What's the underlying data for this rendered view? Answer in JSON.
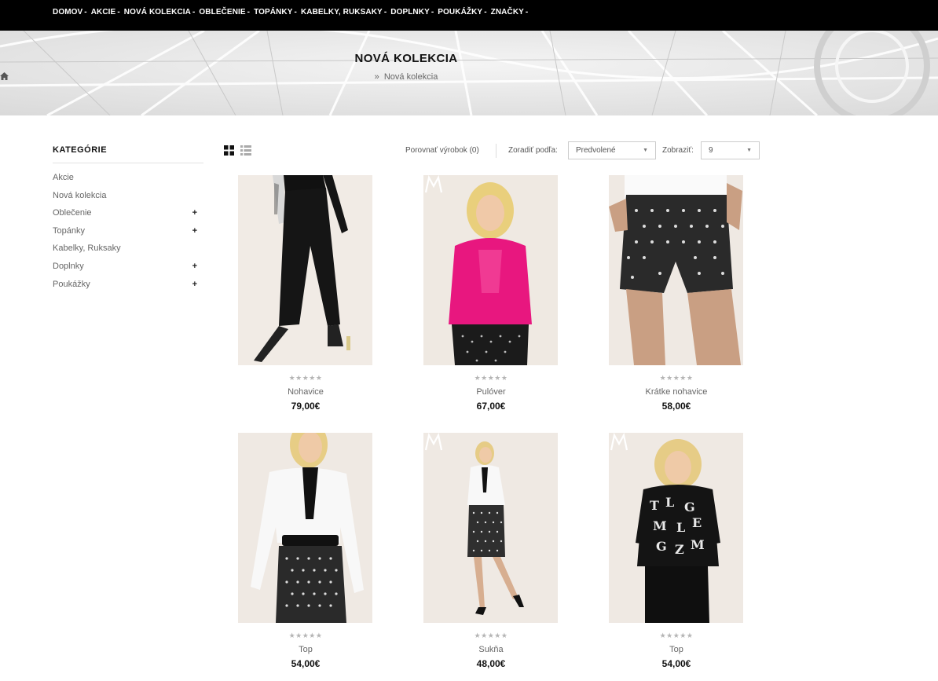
{
  "nav": {
    "items": [
      "DOMOV",
      "AKCIE",
      "NOVÁ KOLEKCIA",
      "OBLEČENIE",
      "TOPÁNKY",
      "KABELKY, RUKSAKY",
      "DOPLNKY",
      "POUKÁŽKY",
      "ZNAČKY"
    ],
    "separator": "-"
  },
  "banner": {
    "title": "NOVÁ KOLEKCIA",
    "breadcrumb_arrow": "»",
    "breadcrumb_current": "Nová kolekcia"
  },
  "sidebar": {
    "title": "KATEGÓRIE",
    "items": [
      {
        "label": "Akcie",
        "expandable": false
      },
      {
        "label": "Nová kolekcia",
        "expandable": false
      },
      {
        "label": "Oblečenie",
        "expandable": true
      },
      {
        "label": "Topánky",
        "expandable": true
      },
      {
        "label": "Kabelky, Ruksaky",
        "expandable": false
      },
      {
        "label": "Doplnky",
        "expandable": true
      },
      {
        "label": "Poukážky",
        "expandable": true
      }
    ],
    "expand_symbol": "+"
  },
  "toolbar": {
    "compare_label": "Porovnať výrobok (0)",
    "sort_label": "Zoradiť podľa:",
    "sort_value": "Predvolené",
    "show_label": "Zobraziť:",
    "show_value": "9",
    "caret": "▼"
  },
  "products": [
    {
      "name": "Nohavice",
      "price": "79,00€",
      "rating": 0,
      "stars": "★★★★★",
      "image": "black-trousers",
      "has_logo": false
    },
    {
      "name": "Pulóver",
      "price": "67,00€",
      "rating": 0,
      "stars": "★★★★★",
      "image": "pink-cardigan",
      "has_logo": true
    },
    {
      "name": "Krátke nohavice",
      "price": "58,00€",
      "rating": 0,
      "stars": "★★★★★",
      "image": "patterned-shorts",
      "has_logo": false
    },
    {
      "name": "Top",
      "price": "54,00€",
      "rating": 0,
      "stars": "★★★★★",
      "image": "white-top",
      "has_logo": false
    },
    {
      "name": "Sukňa",
      "price": "48,00€",
      "rating": 0,
      "stars": "★★★★★",
      "image": "patterned-skirt",
      "has_logo": true
    },
    {
      "name": "Top",
      "price": "54,00€",
      "rating": 0,
      "stars": "★★★★★",
      "image": "letter-print-top",
      "has_logo": true
    }
  ],
  "colors": {
    "nav_bg": "#000000",
    "banner_bg": "#e9e9e9",
    "price": "#111111",
    "star_empty": "#b5b5b5",
    "accent_pink": "#e8177f"
  }
}
